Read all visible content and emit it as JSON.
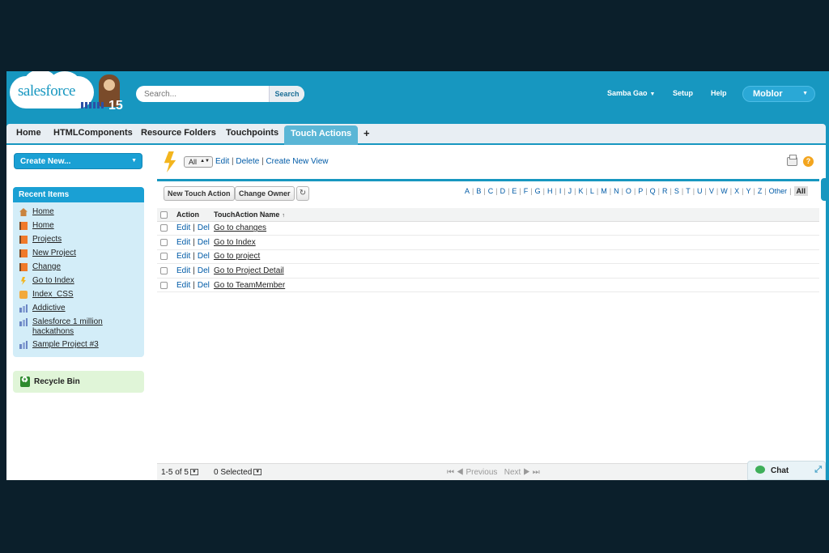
{
  "header": {
    "logo_text": "salesforce",
    "logo_number": "15",
    "search_placeholder": "Search...",
    "search_button": "Search",
    "user_name": "Samba Gao",
    "setup": "Setup",
    "help": "Help",
    "app_name": "Moblor"
  },
  "tabs": [
    {
      "label": "Home"
    },
    {
      "label": "HTMLComponents"
    },
    {
      "label": "Resource Folders"
    },
    {
      "label": "Touchpoints"
    },
    {
      "label": "Touch Actions",
      "active": true
    },
    {
      "label": "+"
    }
  ],
  "sidebar": {
    "create_new": "Create New...",
    "recent_title": "Recent Items",
    "recent_items": [
      {
        "label": "Home",
        "icon": "home-icon"
      },
      {
        "label": "Home",
        "icon": "flag-icon"
      },
      {
        "label": "Projects",
        "icon": "flag-icon"
      },
      {
        "label": "New Project",
        "icon": "flag-icon"
      },
      {
        "label": "Change",
        "icon": "flag-icon"
      },
      {
        "label": "Go to Index",
        "icon": "bolt-icon"
      },
      {
        "label": "Index_CSS",
        "icon": "css-icon"
      },
      {
        "label": "Addictive",
        "icon": "chart-icon"
      },
      {
        "label": "Salesforce 1 million hackathons",
        "icon": "chart-icon"
      },
      {
        "label": "Sample Project #3",
        "icon": "chart-icon"
      }
    ],
    "recycle_bin": "Recycle Bin"
  },
  "listview": {
    "view_selected": "All",
    "edit": "Edit",
    "delete": "Delete",
    "create_new_view": "Create New View",
    "new_button": "New Touch Action",
    "change_owner": "Change Owner",
    "alphabet": [
      "A",
      "B",
      "C",
      "D",
      "E",
      "F",
      "G",
      "H",
      "I",
      "J",
      "K",
      "L",
      "M",
      "N",
      "O",
      "P",
      "Q",
      "R",
      "S",
      "T",
      "U",
      "V",
      "W",
      "X",
      "Y",
      "Z",
      "Other",
      "All"
    ],
    "columns": {
      "action": "Action",
      "name": "TouchAction Name",
      "sort_arrow": "↑"
    },
    "row_edit": "Edit",
    "row_del": "Del",
    "rows": [
      {
        "name": "Go to changes"
      },
      {
        "name": "Go to Index"
      },
      {
        "name": "Go to project"
      },
      {
        "name": "Go to Project Detail"
      },
      {
        "name": "Go to TeamMember"
      }
    ],
    "range": "1-5 of 5",
    "selected": "0 Selected",
    "previous": "Previous",
    "next": "Next"
  },
  "chat": {
    "label": "Chat"
  },
  "colors": {
    "brand_blue": "#1797c0",
    "link_blue": "#015ba7",
    "panel_blue": "#d3edf8",
    "recycle_green": "#e0f5d8"
  }
}
